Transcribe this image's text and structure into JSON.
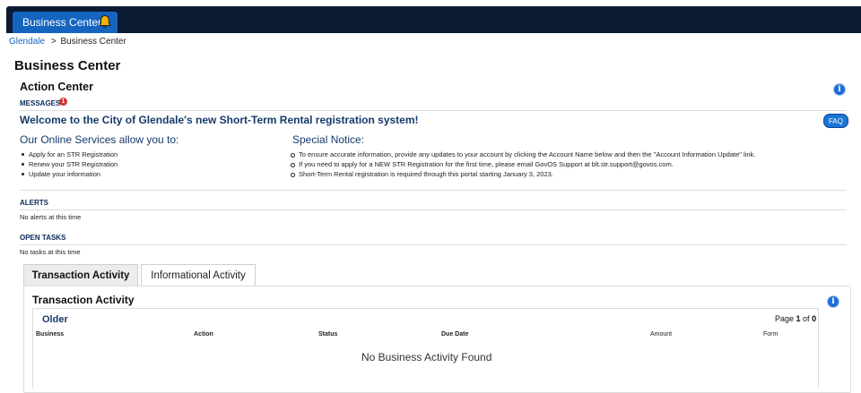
{
  "header": {
    "tab_label": "Business Center",
    "icon": "bell-icon"
  },
  "breadcrumb": {
    "home": "Glendale",
    "separator": ">",
    "current": "Business Center"
  },
  "page_title": "Business Center",
  "action_center": {
    "title": "Action Center",
    "messages_label": "MESSAGES",
    "messages_count": "1",
    "welcome": "Welcome to the City of Glendale's new Short-Term Rental registration system!",
    "faq_label": "FAQ",
    "services_heading": "Our Online Services allow you to:",
    "services": [
      "Apply for an STR Registration",
      "Renew your STR Registration",
      "Update your information"
    ],
    "notice_heading": "Special Notice:",
    "notices": [
      "To ensure accurate information, provide any updates to your account by clicking the Account Name below and then the \"Account Information Update\" link.",
      "If you need to apply for a NEW STR Registration for the first time, please email GovOS Support at blt.str.support@govos.com.",
      "Short-Term Rental registration is required through this portal starting January 3, 2023."
    ],
    "alerts_label": "ALERTS",
    "alerts_text": "No alerts at this time",
    "tasks_label": "OPEN TASKS",
    "tasks_text": "No tasks at this time"
  },
  "tabs": [
    {
      "label": "Transaction Activity",
      "active": true
    },
    {
      "label": "Informational Activity",
      "active": false
    }
  ],
  "transaction_panel": {
    "title": "Transaction Activity",
    "older_label": "Older",
    "page_prefix": "Page ",
    "page_current": "1",
    "page_mid": " of ",
    "page_total": "0",
    "columns": [
      "Business",
      "Action",
      "Status",
      "Due Date",
      "Amount",
      "Form"
    ],
    "empty_text": "No Business Activity Found"
  },
  "colors": {
    "topbar": "#0c1a33",
    "accent": "#1565c0",
    "heading": "#163a6b",
    "badge": "#d32f2f"
  }
}
